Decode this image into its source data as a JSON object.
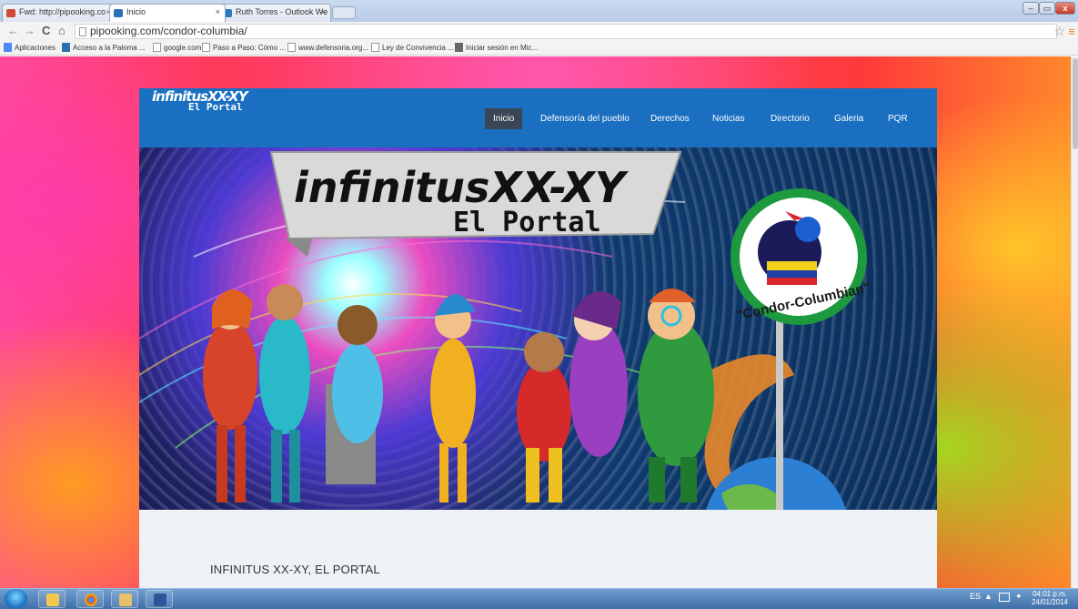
{
  "browser": {
    "tabs": [
      {
        "label": "Fwd: http://pipooking.co",
        "favicon_color": "#d14836",
        "active": false
      },
      {
        "label": "Inicio",
        "favicon_color": "#2c6fb5",
        "active": true
      },
      {
        "label": "Ruth Torres - Outlook We",
        "favicon_color": "#2a7ac0",
        "active": false
      }
    ],
    "close_glyph": "×",
    "window_controls": {
      "minimize": "–",
      "maximize": "▭",
      "close": "x"
    },
    "url": "pipooking.com/condor-columbia/",
    "back": "←",
    "forward": "→",
    "reload": "C",
    "home": "⌂",
    "star": "☆",
    "menu": "≡",
    "bookmarks": [
      {
        "label": "Aplicaciones"
      },
      {
        "label": "Acceso a la Paloma ..."
      },
      {
        "label": "google.com"
      },
      {
        "label": "Paso a Paso: Cómo ..."
      },
      {
        "label": "www.defensoria.org..."
      },
      {
        "label": "Ley de Convivencia ..."
      },
      {
        "label": "Iniciar sesión en Mic..."
      }
    ]
  },
  "site": {
    "logo_line1": "infinitusXX-XY",
    "logo_line2": "El Portal",
    "nav": [
      {
        "label": "Inicio",
        "active": true
      },
      {
        "label": "Defensoría del pueblo"
      },
      {
        "label": "Derechos"
      },
      {
        "label": "Noticias"
      },
      {
        "label": "Directorio"
      },
      {
        "label": "Galeria"
      },
      {
        "label": "PQR"
      }
    ],
    "hero": {
      "banner_line1": "infinitusXX-XY",
      "banner_line2": "El Portal",
      "badge_text": "\"Condor-Columbian\""
    },
    "content_title": "INFINITUS XX-XY, EL PORTAL",
    "header_color": "#1a6fc0"
  },
  "taskbar": {
    "lang": "ES",
    "time": "04:01 p.m.",
    "date": "24/01/2014"
  }
}
